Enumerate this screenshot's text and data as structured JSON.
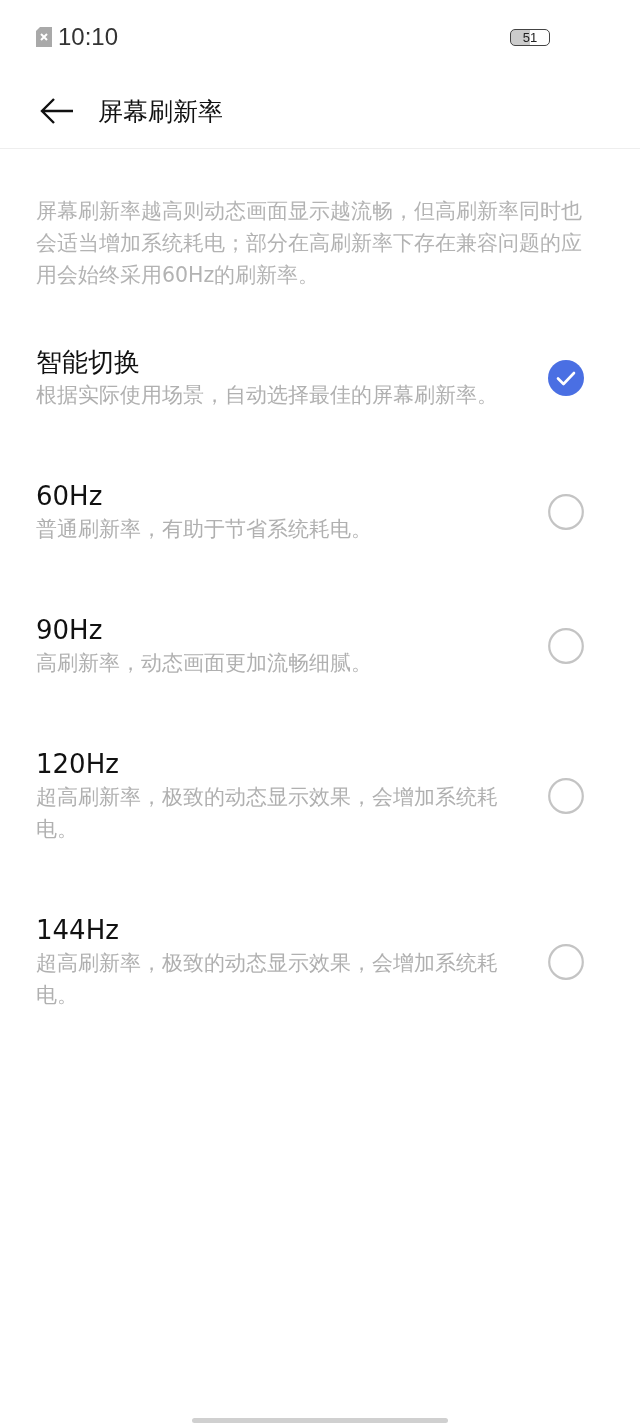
{
  "status_bar": {
    "time": "10:10",
    "battery": "51"
  },
  "header": {
    "title": "屏幕刷新率"
  },
  "description": "屏幕刷新率越高则动态画面显示越流畅，但高刷新率同时也会适当增加系统耗电；部分在高刷新率下存在兼容问题的应用会始终采用60Hz的刷新率。",
  "options": [
    {
      "title": "智能切换",
      "subtitle": "根据实际使用场景，自动选择最佳的屏幕刷新率。",
      "selected": true
    },
    {
      "title": "60Hz",
      "subtitle": "普通刷新率，有助于节省系统耗电。",
      "selected": false
    },
    {
      "title": "90Hz",
      "subtitle": "高刷新率，动态画面更加流畅细腻。",
      "selected": false
    },
    {
      "title": "120Hz",
      "subtitle": "超高刷新率，极致的动态显示效果，会增加系统耗电。",
      "selected": false
    },
    {
      "title": "144Hz",
      "subtitle": "超高刷新率，极致的动态显示效果，会增加系统耗电。",
      "selected": false
    }
  ]
}
